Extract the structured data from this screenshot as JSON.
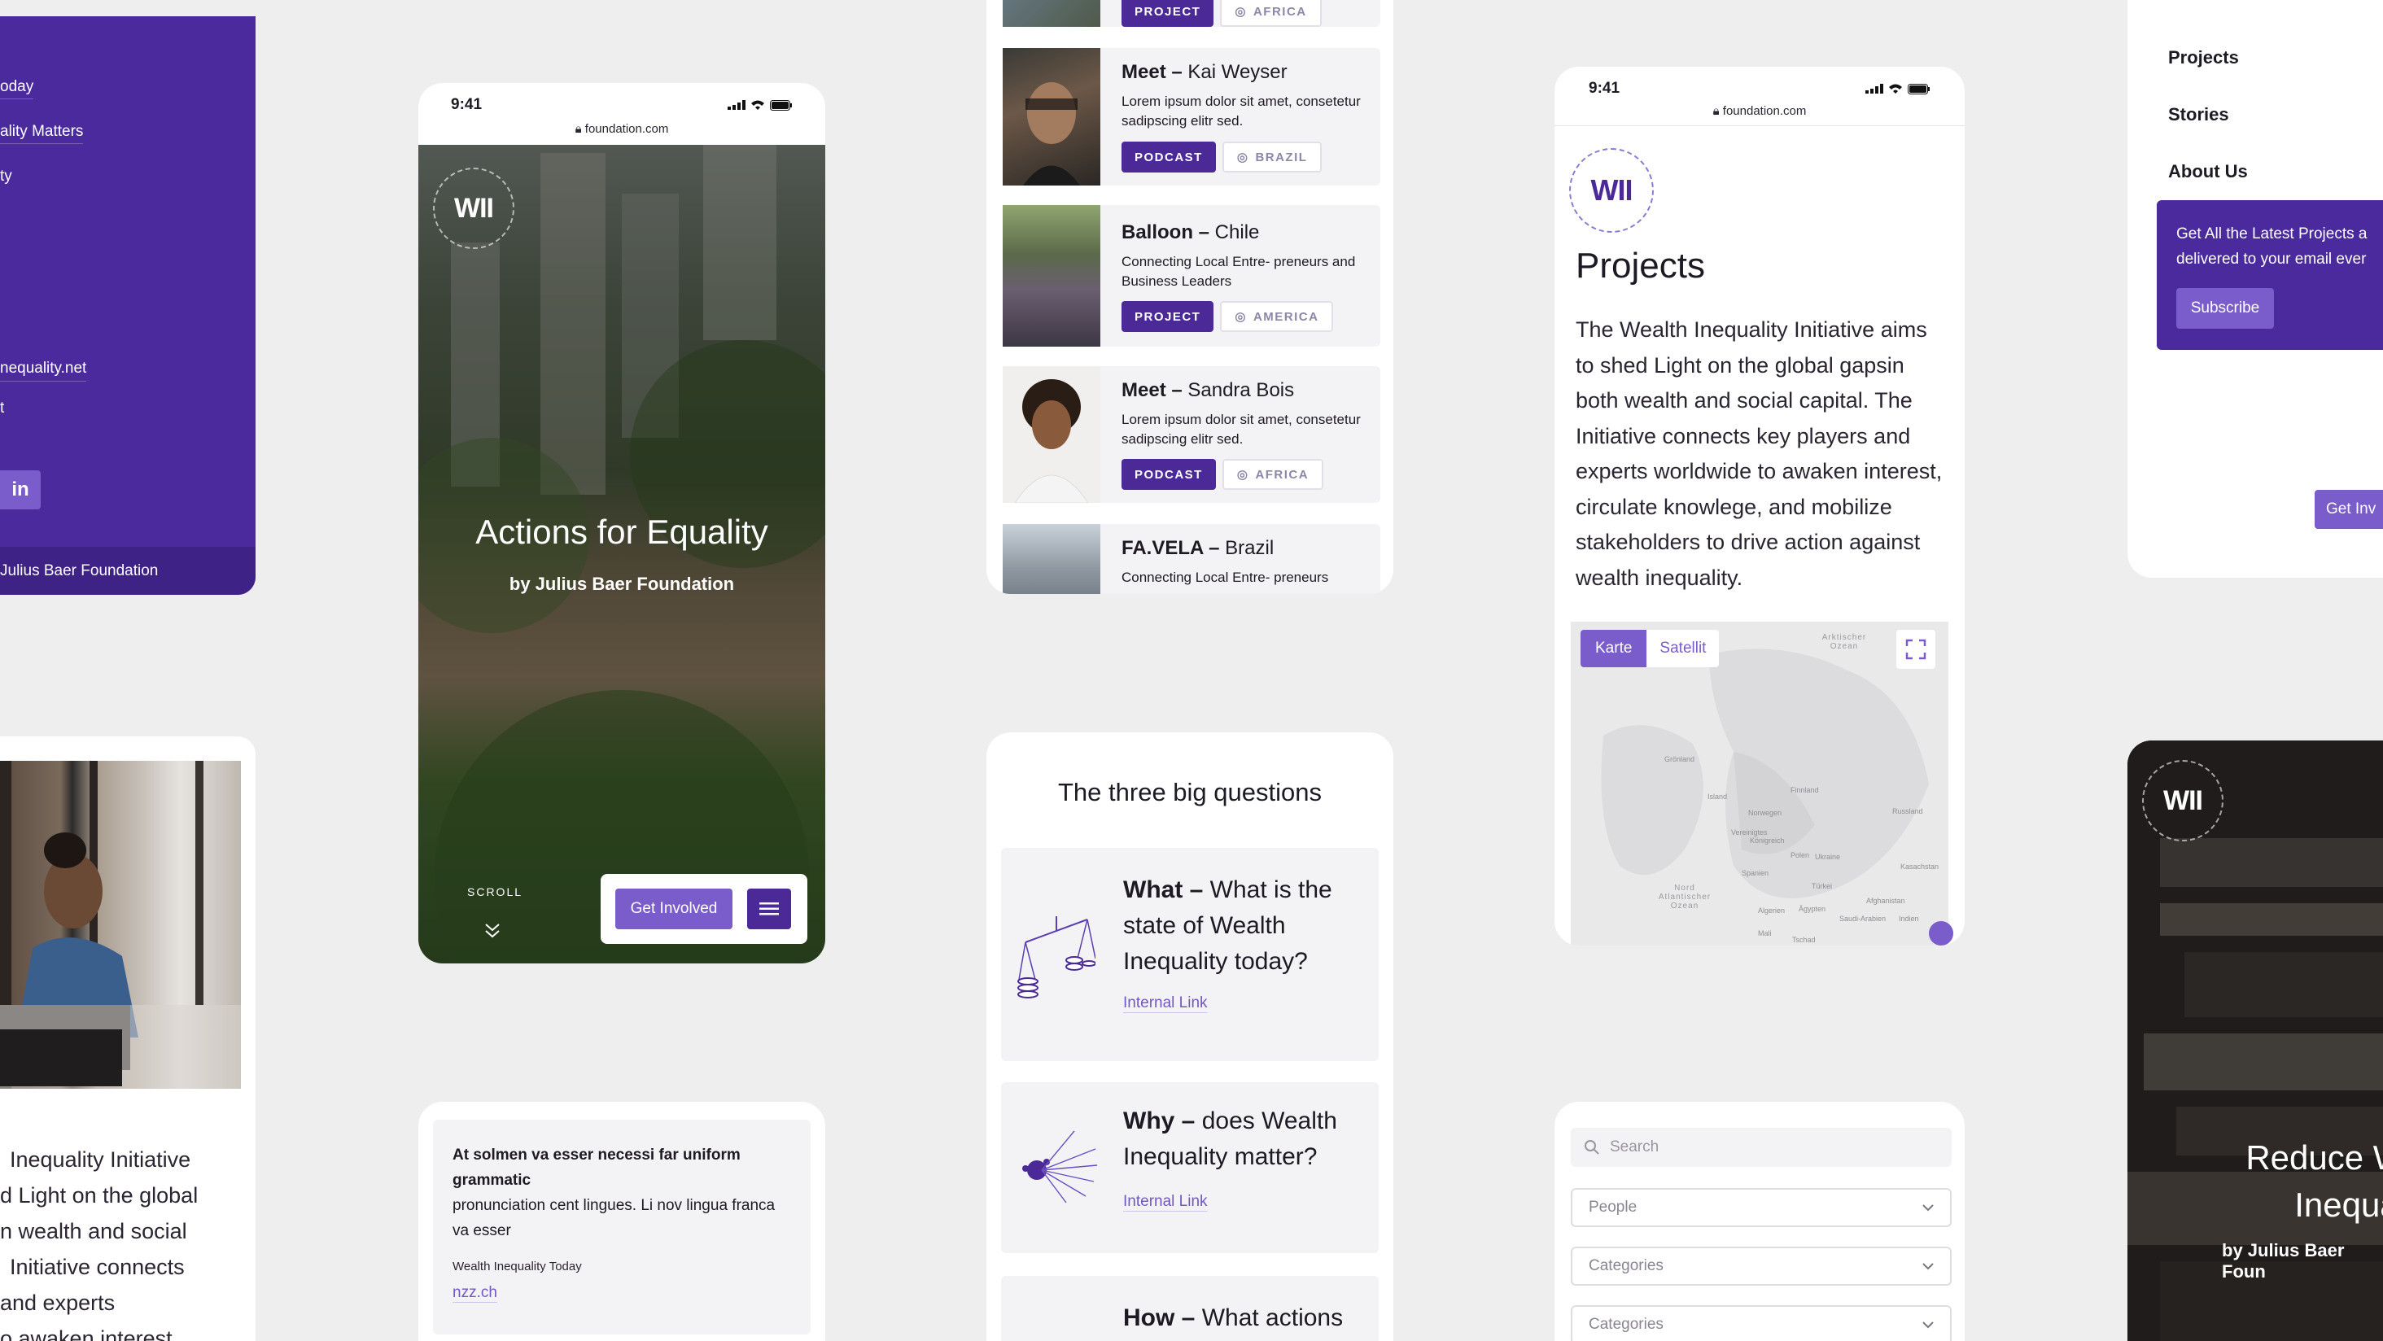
{
  "colors": {
    "brand_purple": "#4b2a98",
    "accent_violet": "#7b5ccb",
    "page_bg": "#efeeef"
  },
  "menu_panel": {
    "links": [
      "oday",
      "ality Matters",
      "ty",
      "nequality.net",
      "t"
    ],
    "social": "in",
    "footer": "Julius Baer Foundation"
  },
  "phone_hero": {
    "time": "9:41",
    "url": "foundation.com",
    "logo": "WII",
    "title": "Actions for Equality",
    "subtitle": "by Julius Baer Foundation",
    "scroll": "SCROLL",
    "cta": "Get Involved"
  },
  "stories_list": {
    "top_tags": [
      "PROJECT",
      "AFRICA"
    ],
    "items": [
      {
        "title_bold": "Meet –",
        "title_rest": " Kai Weyser",
        "desc": "Lorem ipsum dolor sit amet, consetetur sadipscing elitr sed.",
        "tag": "PODCAST",
        "region": "BRAZIL"
      },
      {
        "title_bold": "Balloon –",
        "title_rest": " Chile",
        "desc": "Connecting Local Entre- preneurs and Business Leaders",
        "tag": "PROJECT",
        "region": "AMERICA"
      },
      {
        "title_bold": "Meet –",
        "title_rest": " Sandra Bois",
        "desc": "Lorem ipsum dolor sit amet, consetetur sadipscing elitr sed.",
        "tag": "PODCAST",
        "region": "AFRICA"
      },
      {
        "title_bold": "FA.VELA –",
        "title_rest": " Brazil",
        "desc": "Connecting Local Entre- preneurs",
        "tag": "",
        "region": ""
      }
    ]
  },
  "projects_phone": {
    "time": "9:41",
    "url": "foundation.com",
    "logo": "WII",
    "title": "Projects",
    "body": "The Wealth Inequality Initiative aims to shed Light on the global gapsin both wealth and social capital. The Initiative connects key players and experts worldwide to awaken interest, circulate knowlege, and mobilize stakeholders to drive action against wealth inequality.",
    "map_tabs": [
      "Karte",
      "Satellit"
    ],
    "map_labels": [
      "Arktischer Ozean",
      "Nord Atlantischer Ozean"
    ]
  },
  "right_nav": {
    "items": [
      "Projects",
      "Stories",
      "About Us"
    ],
    "newsletter_text": "Get All the Latest Projects a delivered to your email ever",
    "subscribe": "Subscribe",
    "cta": "Get Inv"
  },
  "woman_card": {
    "text_lines": [
      "Inequality Initiative",
      "d Light on the global",
      "n wealth and social",
      "Initiative connects",
      "and experts",
      "o awaken interest"
    ]
  },
  "questions": {
    "heading": "The three big questions",
    "items": [
      {
        "bold": "What –",
        "rest": " What is the state of Wealth Inequality today?",
        "link": "Internal Link"
      },
      {
        "bold": "Why –",
        "rest": " does Wealth Inequality matter?",
        "link": "Internal Link"
      },
      {
        "bold": "How –",
        "rest": " What actions",
        "link": ""
      }
    ]
  },
  "quote_card": {
    "bold": "At solmen va esser necessi far uniform grammatic",
    "rest": "pronunciation cent lingues. Li nov lingua franca va esser",
    "source": "Wealth Inequality Today",
    "link": "nzz.ch"
  },
  "filters": {
    "search_placeholder": "Search",
    "selects": [
      "People",
      "Categories",
      "Categories"
    ]
  },
  "reduce_card": {
    "logo": "WII",
    "title_lines": [
      "Reduce We",
      "Inequalit"
    ],
    "subtitle": "by Julius Baer Foun"
  }
}
